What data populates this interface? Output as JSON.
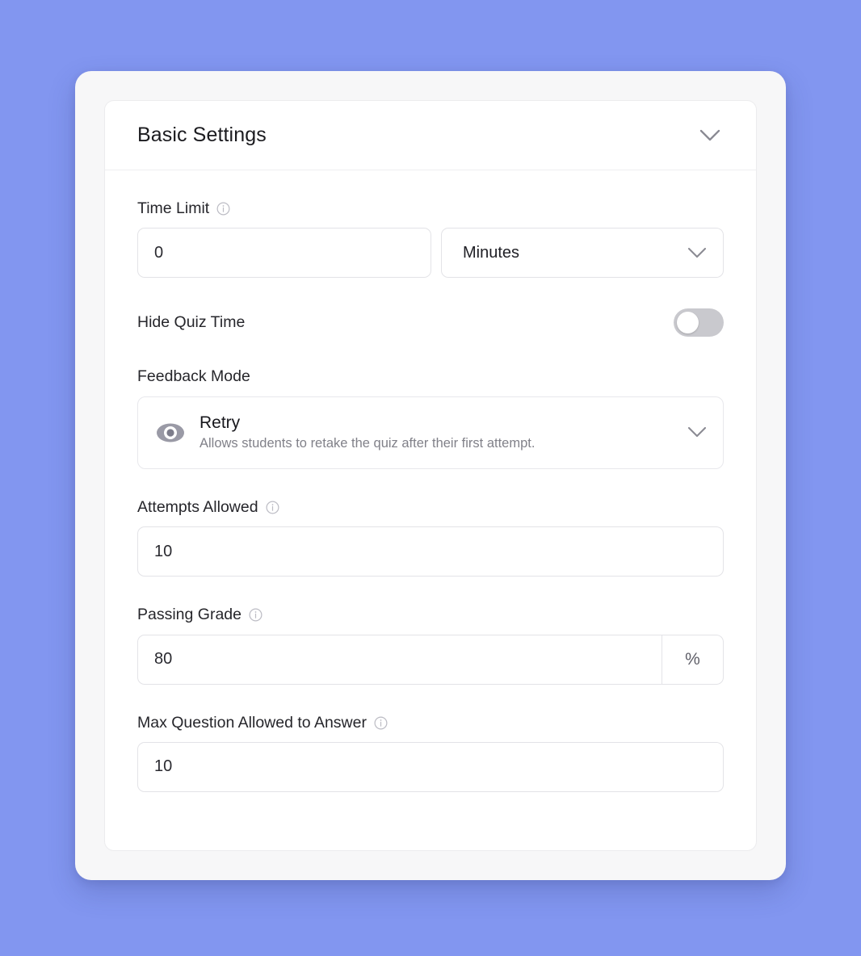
{
  "theme": {
    "background": "#8296f0",
    "outer_card": "#f7f7f8",
    "panel": "#ffffff",
    "border": "#e3e3e7",
    "text": "#26262b",
    "muted_text": "#818189",
    "toggle_off_track": "#c9c9ce",
    "icon_gray": "#8a8a93"
  },
  "panel": {
    "title": "Basic Settings",
    "collapse_icon": "chevron-down-icon"
  },
  "fields": {
    "time_limit": {
      "label": "Time Limit",
      "info_icon": "info-icon",
      "value": "0",
      "placeholder": "0",
      "unit_select": {
        "value": "Minutes",
        "icon": "chevron-down-icon"
      }
    },
    "hide_quiz_time": {
      "label": "Hide Quiz Time",
      "toggle_state": "off"
    },
    "feedback_mode": {
      "label": "Feedback Mode",
      "selected": {
        "icon": "eye-icon",
        "title": "Retry",
        "description": "Allows students to retake the quiz after their first attempt."
      },
      "chevron_icon": "chevron-down-icon"
    },
    "attempts_allowed": {
      "label": "Attempts Allowed",
      "info_icon": "info-icon",
      "value": "10",
      "placeholder": "10"
    },
    "passing_grade": {
      "label": "Passing Grade",
      "info_icon": "info-icon",
      "value": "80",
      "placeholder": "80",
      "unit": "%"
    },
    "max_question_allowed": {
      "label": "Max Question Allowed to Answer",
      "info_icon": "info-icon",
      "value": "10",
      "placeholder": "10"
    }
  }
}
